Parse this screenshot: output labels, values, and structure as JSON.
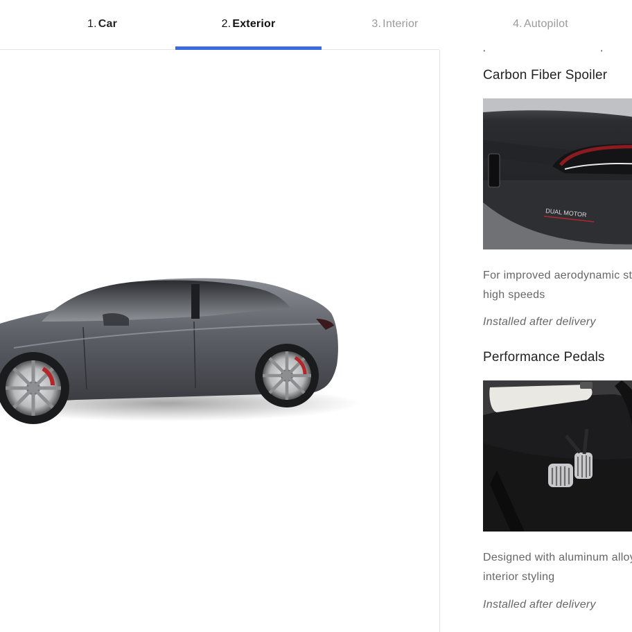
{
  "nav": {
    "tabs": [
      {
        "num": "1.",
        "label": "Car"
      },
      {
        "num": "2.",
        "label": "Exterior"
      },
      {
        "num": "3.",
        "label": "Interior"
      },
      {
        "num": "4.",
        "label": "Autopilot"
      }
    ],
    "active_index": 1,
    "accent_color": "#3e6ae1"
  },
  "left": {
    "car_image": "car-side-view-gray"
  },
  "options_panel": {
    "clipped_text": "performance brake calipers",
    "items": [
      {
        "title": "Carbon Fiber Spoiler",
        "image": "rear-spoiler-dual-motor-badge",
        "badge_text": "DUAL MOTOR",
        "description_lines": [
          "For improved aerodynamic stability at",
          "high speeds"
        ],
        "note": "Installed after delivery"
      },
      {
        "title": "Performance Pedals",
        "image": "aluminum-pedals-footwell",
        "description_lines": [
          "Designed with aluminum alloy for a sporty",
          "interior styling"
        ],
        "note": "Installed after delivery"
      }
    ]
  }
}
